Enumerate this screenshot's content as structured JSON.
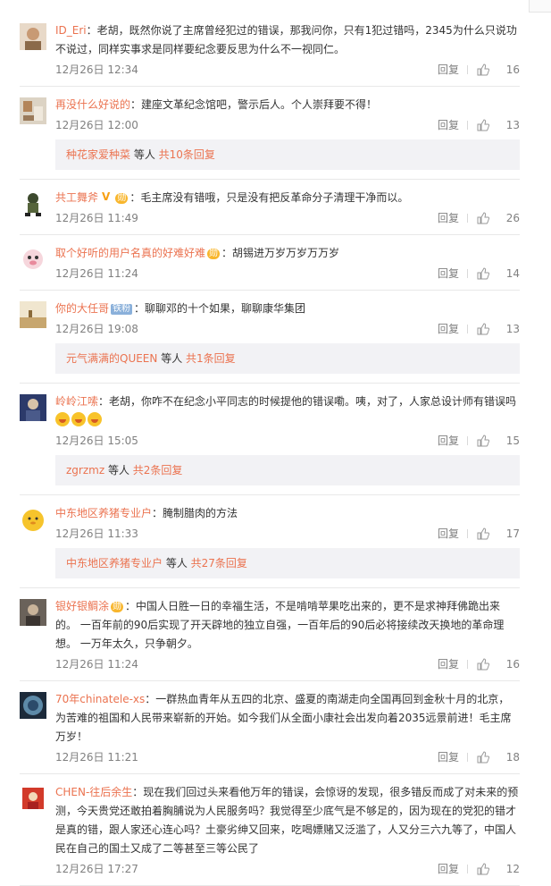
{
  "ui": {
    "reply_label": "回复",
    "subreply_mid": " 等人 ",
    "like_icon": "thumb-up-icon"
  },
  "comments": [
    {
      "username": "ID_Eri",
      "text": "：老胡，既然你说了主席曾经犯过的错误，那我问你，只有1犯过错吗，2345为什么只说功不说过，同样实事求是同样要纪念要反思为什么不一视同仁。",
      "time": "12月26日 12:34",
      "likes": "16"
    },
    {
      "username": "再没什么好说的",
      "text": "：建座文革纪念馆吧，警示后人。个人崇拜要不得！",
      "time": "12月26日 12:00",
      "likes": "13",
      "subreply": {
        "name": "种花家爱种菜",
        "total": "共10条回复"
      }
    },
    {
      "username": "共工舞斧",
      "badges": [
        "V",
        "勋"
      ],
      "text": "：毛主席没有错哦，只是没有把反革命分子清理干净而以。",
      "time": "12月26日 11:49",
      "likes": "26"
    },
    {
      "username": "取个好听的用户名真的好难好难",
      "badges": [
        "勋"
      ],
      "text": "：胡锡进万岁万岁万万岁",
      "time": "12月26日 11:24",
      "likes": "14"
    },
    {
      "username": "你的大任哥",
      "badges": [
        "铁粉"
      ],
      "text": "：聊聊邓的十个如果，聊聊康华集团",
      "time": "12月26日 19:08",
      "likes": "13",
      "subreply": {
        "name": "元气满满的QUEEN",
        "total": "共1条回复"
      }
    },
    {
      "username": "岭岭江嗦",
      "text": "：老胡，你咋不在纪念小平同志的时候提他的错误嘞。咦，对了，人家总设计师有错误吗",
      "emoji": "laugh-cry-emoji",
      "time": "12月26日 15:05",
      "likes": "15",
      "subreply": {
        "name": "zgrzmz",
        "total": "共2条回复"
      }
    },
    {
      "username": "中东地区养猪专业户",
      "text": "：腌制腊肉的方法",
      "time": "12月26日 11:33",
      "likes": "17",
      "subreply": {
        "name": "中东地区养猪专业户",
        "total": "共27条回复"
      }
    },
    {
      "username": "银好银鲷涂",
      "badges": [
        "勋"
      ],
      "text": "：中国人日胜一日的幸福生活，不是啃啃苹果吃出来的，更不是求神拜佛跪出来的。 一百年前的90后实现了开天辟地的独立自强，一百年后的90后必将接续改天换地的革命理想。 一万年太久，只争朝夕。",
      "time": "12月26日 11:24",
      "likes": "16"
    },
    {
      "username": "70年chinatele-xs",
      "text": "：一群热血青年从五四的北京、盛夏的南湖走向全国再回到金秋十月的北京，为苦难的祖国和人民带来崭新的开始。如今我们从全面小康社会出发向着2035远景前进！毛主席万岁！",
      "time": "12月26日 11:21",
      "likes": "18"
    },
    {
      "username": "CHEN-往后余生",
      "text": "：现在我们回过头来看他万年的错误，会惊讶的发现，很多错反而成了对未来的预测，今天贵党还敢拍着胸脯说为人民服务吗？我觉得至少底气是不够足的，因为现在的党犯的错才是真的错，跟人家还心连心吗？土豪劣绅又回来，吃喝嫖赌又泛滥了，人又分三六九等了，中国人民在自己的国土又成了二等甚至三等公民了",
      "time": "12月26日 17:27",
      "likes": "12"
    }
  ]
}
